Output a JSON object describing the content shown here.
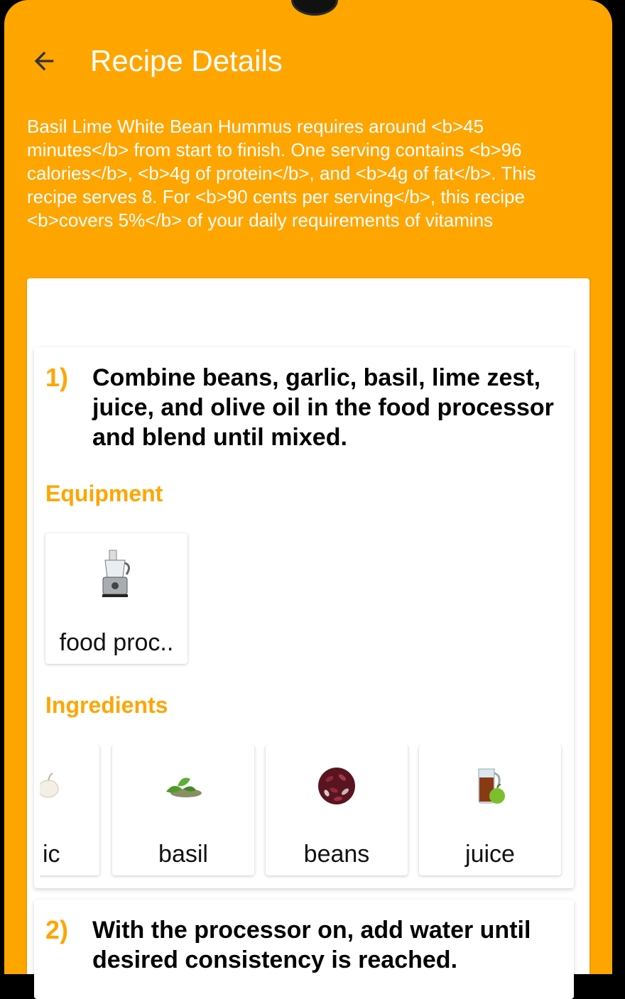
{
  "app": {
    "title": "Recipe Details",
    "accent_color": "#FFA500"
  },
  "summary": "Basil Lime White Bean Hummus requires around <b>45 minutes</b> from start to finish. One serving contains <b>96 calories</b>, <b>4g of protein</b>, and <b>4g of fat</b>. This recipe serves 8. For <b>90 cents per serving</b>, this recipe <b>covers 5%</b> of your daily requirements of vitamins",
  "steps": [
    {
      "number": "1)",
      "text": "Combine beans, garlic, basil, lime zest, juice, and olive oil in the food processor and blend until mixed.",
      "equipment_title": "Equipment",
      "equipment": [
        {
          "label": "food proc..",
          "icon": "food-processor-icon"
        }
      ],
      "ingredients_title": "Ingredients",
      "ingredients": [
        {
          "label": "ic",
          "icon": "garlic-icon"
        },
        {
          "label": "basil",
          "icon": "basil-icon"
        },
        {
          "label": "beans",
          "icon": "beans-icon"
        },
        {
          "label": "juice",
          "icon": "juice-icon"
        }
      ]
    },
    {
      "number": "2)",
      "text": "With the processor on, add water until desired consistency is reached."
    }
  ]
}
